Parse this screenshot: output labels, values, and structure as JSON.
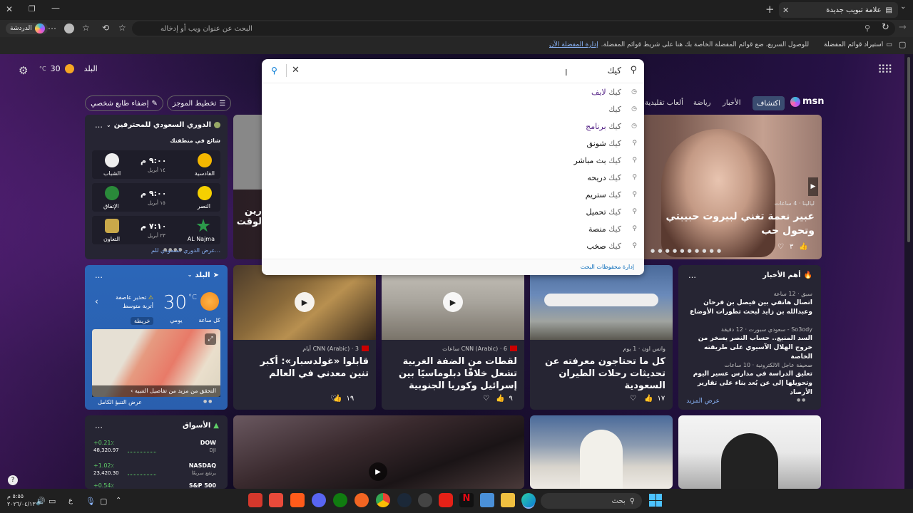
{
  "browser": {
    "tab_title": "علامة تبويب جديدة",
    "address_placeholder": "البحث عن عنوان ويب أو إدخاله",
    "profile_label": "الدردشة",
    "favorites_import": "استيراد قوائم المفضلة",
    "favorites_hint": "للوصول السريع، ضع قوائم المفضلة الخاصة بك هنا على شريط قوائم المفضلة.",
    "favorites_manage": "إدارة المفضلة الآن"
  },
  "header": {
    "location": "البلد",
    "temp": "30",
    "unit": "°C"
  },
  "search": {
    "query": "كيك",
    "suggestions": [
      {
        "prefix": "كيك",
        "suffix": " لايف",
        "type": "history"
      },
      {
        "prefix": "كيك",
        "suffix": "",
        "type": "history"
      },
      {
        "prefix": "كيك",
        "suffix": " برنامج",
        "type": "history"
      },
      {
        "prefix": "كيك",
        "suffix": " شونق",
        "type": "search"
      },
      {
        "prefix": "كيك",
        "suffix": " بث مباشر",
        "type": "search"
      },
      {
        "prefix": "كيك",
        "suffix": " دريحه",
        "type": "search"
      },
      {
        "prefix": "كيك",
        "suffix": " ستريم",
        "type": "search"
      },
      {
        "prefix": "كيك",
        "suffix": " تحميل",
        "type": "search"
      },
      {
        "prefix": "كيك",
        "suffix": " منصة",
        "type": "search"
      },
      {
        "prefix": "كيك",
        "suffix": " صخب",
        "type": "search"
      }
    ],
    "manage": "إدارة محفوظات البحث"
  },
  "nav": {
    "logo": "msn",
    "tabs": [
      "اكتشاف",
      "الأخبار",
      "رياضة",
      "ألعاب تقليدية"
    ],
    "layout_btn": "تخطيط الموجز",
    "personalize_btn": "إضفاء طابع شخصي"
  },
  "hero": {
    "source": "ليالينا · 4 ساعات",
    "title": "عبير نعمة تغني لبيروت حبيبتي وتحول حب",
    "likes": "٣",
    "left_title_1": "رين",
    "left_title_2": "لوقت"
  },
  "sports": {
    "league": "الدوري السعودي للمحترفين",
    "trending": "شائع في منطقتك",
    "matches": [
      {
        "home": "القادسية",
        "away": "الشباب",
        "time": "٩:٠٠ م",
        "date": "١٤ أبريل"
      },
      {
        "home": "النصر",
        "away": "الإتفاق",
        "time": "٩:٠٠ م",
        "date": "١٥ أبريل"
      },
      {
        "home": "AL Najma",
        "away": "التعاون",
        "time": "٧:١٠ م",
        "date": "٢٣ أبريل"
      }
    ],
    "more": "عرض الدوري السعودي للم..."
  },
  "weather": {
    "location": "البلد",
    "temp": "30",
    "unit": "°C",
    "alert": "تحذير عاصفة أتربة متوسط",
    "tabs": [
      "كل ساعة",
      "يومي",
      "خريطة"
    ],
    "map_link": "التحقق من مزيد من تفاصيل التنبيه",
    "full": "عرض التنبؤ الكامل"
  },
  "cards": [
    {
      "source": "CNN (Arabic) · 3 أيام",
      "title": "قابلوا «غولدسبار»: أكبر تنين معدني في العالم",
      "likes": "١٩"
    },
    {
      "source": "CNN (Arabic) · 6 ساعات",
      "title": "لقطات من الضفة الغربية تشعل خلافًا دبلوماسيًا بين إسرائيل وكوريا الجنوبية",
      "likes": "٩"
    },
    {
      "source": "واتس اون · 1 يوم",
      "title": "كل ما تحتاجون معرفته عن تحديثات رحلات الطيران السعودية",
      "likes": "١٧"
    }
  ],
  "top_news": {
    "title": "أهم الأخبار",
    "items": [
      {
        "source": "سبق · 12 ساعة",
        "title": "اتصال هاتفي بين فيصل بن فرحان وعبدالله بن زايد لبحث تطورات الأوضاع"
      },
      {
        "source": "So3ody - سعودي سبورت · 12 دقيقة",
        "title": "السد المنيع.. حساب النصر يسخر من خروج الهلال الآسيوي على طريقته الخاصة"
      },
      {
        "source": "صحيفة عاجل الالكترونية · 10 ساعات",
        "title": "تعليق الدراسة في مدارس عسير اليوم وتحويلها إلى عن بُعد بناء على تقارير الأرصاد"
      }
    ],
    "more": "عرض المزيد"
  },
  "markets": {
    "title": "الأسواق",
    "rows": [
      {
        "name": "DOW",
        "sub": "DJI",
        "change": "+0.21٪",
        "value": "48,320.97"
      },
      {
        "name": "NASDAQ",
        "sub": "يرتفع سريعًا",
        "change": "+1.02٪",
        "value": "23,420.30"
      },
      {
        "name": "S&P 500",
        "sub": "",
        "change": "+0.54٪",
        "value": ""
      }
    ]
  },
  "taskbar": {
    "search": "بحث",
    "time": "٥:٥٥ م",
    "date": "٢٠٢٦/٠٤/١٣",
    "lang": "ع"
  },
  "colors": {
    "accent": "#0078d4",
    "positive": "#5fd068",
    "orange": "#f5a623"
  }
}
